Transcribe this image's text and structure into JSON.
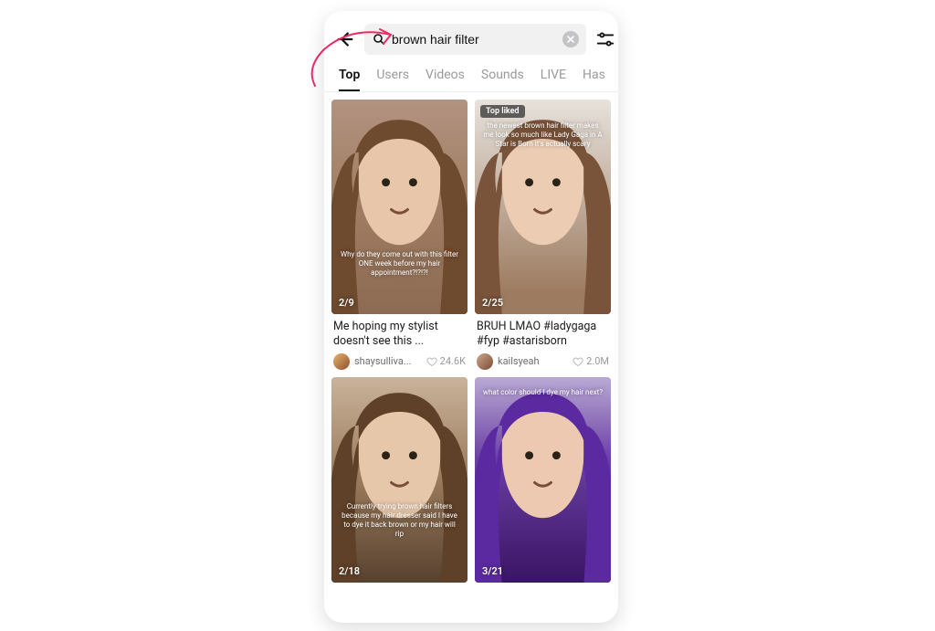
{
  "search": {
    "value": "brown hair filter"
  },
  "tabs": {
    "items": [
      "Top",
      "Users",
      "Videos",
      "Sounds",
      "LIVE",
      "Has"
    ],
    "active_index": 0
  },
  "results": [
    {
      "badge": null,
      "overlay_text": "Why do they come out with this filter ONE week before my hair appointment?!?!?!",
      "overlay_pos": "bottom:40px;",
      "date": "2/9",
      "caption": "Me hoping my stylist doesn't see this ...",
      "user": "shaysulliva...",
      "likes": "24.6K",
      "bg": "linear-gradient(180deg,#b29381 0%,#a27f64 45%,#8c6a53 100%)",
      "avatar_bg": "linear-gradient(135deg,#e9b36c,#8a5230)"
    },
    {
      "badge": "Top liked",
      "overlay_text": "the newest brown hair filter makes me look so much like Lady Gaga in A Star is Born it's actually scary",
      "overlay_pos": "top:24px;",
      "date": "2/25",
      "caption": "BRUH LMAO #ladygaga #fyp #astarisborn",
      "user": "kailsyeah",
      "likes": "2.0M",
      "bg": "linear-gradient(180deg,#e7e2dc 0%,#9d7b60 90%)",
      "avatar_bg": "linear-gradient(135deg,#d0a58c,#7a4b34)"
    },
    {
      "badge": null,
      "overlay_text": "Currently trying brown hair filters because my hair dresser said I have to dye it back brown or my hair will rip",
      "overlay_pos": "bottom:48px;",
      "date": "2/18",
      "caption": null,
      "user": null,
      "likes": null,
      "bg": "linear-gradient(180deg,#c9b39a 0%,#9a7a5c 50%,#57412f 100%)",
      "avatar_bg": ""
    },
    {
      "badge": null,
      "overlay_text": "what color should I dye my hair next?",
      "overlay_pos": "top:12px;",
      "date": "3/21",
      "caption": null,
      "user": null,
      "likes": null,
      "bg": "linear-gradient(180deg,#b9a9d4 0%,#6a3fa3 40%,#3a1464 100%)",
      "avatar_bg": ""
    }
  ]
}
